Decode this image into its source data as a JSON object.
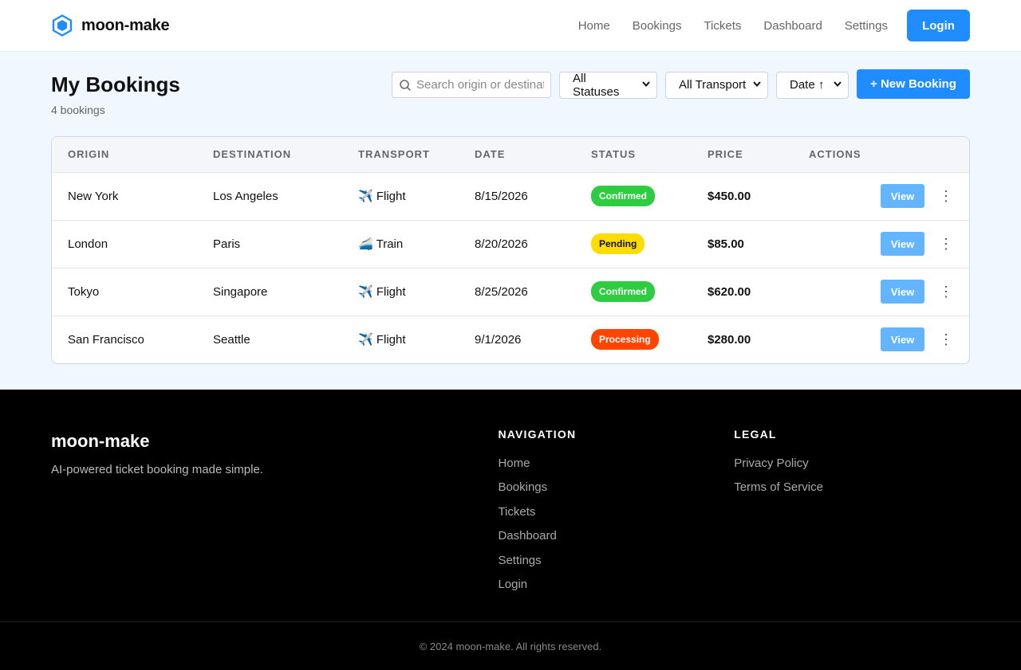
{
  "brand": {
    "name": "moon-make",
    "logo_icon": "hexagon-icon",
    "accent": "#1f8cff"
  },
  "nav": {
    "links": [
      "Home",
      "Bookings",
      "Tickets",
      "Dashboard",
      "Settings"
    ],
    "login_label": "Login"
  },
  "page": {
    "title": "My Bookings",
    "subtitle": "4 bookings",
    "search_placeholder": "Search origin or destination...",
    "status_filter": "All Statuses",
    "transport_filter": "All Transport",
    "sort": "Date ↑",
    "new_label": "+ New Booking"
  },
  "table": {
    "headers": [
      "ORIGIN",
      "DESTINATION",
      "TRANSPORT",
      "DATE",
      "STATUS",
      "PRICE",
      "ACTIONS"
    ],
    "view_label": "View",
    "rows": [
      {
        "origin": "New York",
        "destination": "Los Angeles",
        "transport_icon": "✈️",
        "transport": "Flight",
        "date": "8/15/2026",
        "status": "Confirmed",
        "status_color": "#2ecc40",
        "status_text_color": "#ffffff",
        "price": "$450.00"
      },
      {
        "origin": "London",
        "destination": "Paris",
        "transport_icon": "🚄",
        "transport": "Train",
        "date": "8/20/2026",
        "status": "Pending",
        "status_color": "#ffdc00",
        "status_text_color": "#111111",
        "price": "$85.00"
      },
      {
        "origin": "Tokyo",
        "destination": "Singapore",
        "transport_icon": "✈️",
        "transport": "Flight",
        "date": "8/25/2026",
        "status": "Confirmed",
        "status_color": "#2ecc40",
        "status_text_color": "#ffffff",
        "price": "$620.00"
      },
      {
        "origin": "San Francisco",
        "destination": "Seattle",
        "transport_icon": "✈️",
        "transport": "Flight",
        "date": "9/1/2026",
        "status": "Processing",
        "status_color": "#ff4500",
        "status_text_color": "#ffffff",
        "price": "$280.00"
      }
    ]
  },
  "footer": {
    "name": "moon-make",
    "tagline": "AI-powered ticket booking made simple.",
    "nav_heading": "NAVIGATION",
    "nav_links": [
      "Home",
      "Bookings",
      "Tickets",
      "Dashboard",
      "Settings",
      "Login"
    ],
    "legal_heading": "LEGAL",
    "legal_links": [
      "Privacy Policy",
      "Terms of Service"
    ],
    "copyright": "© 2024 moon-make. All rights reserved."
  }
}
